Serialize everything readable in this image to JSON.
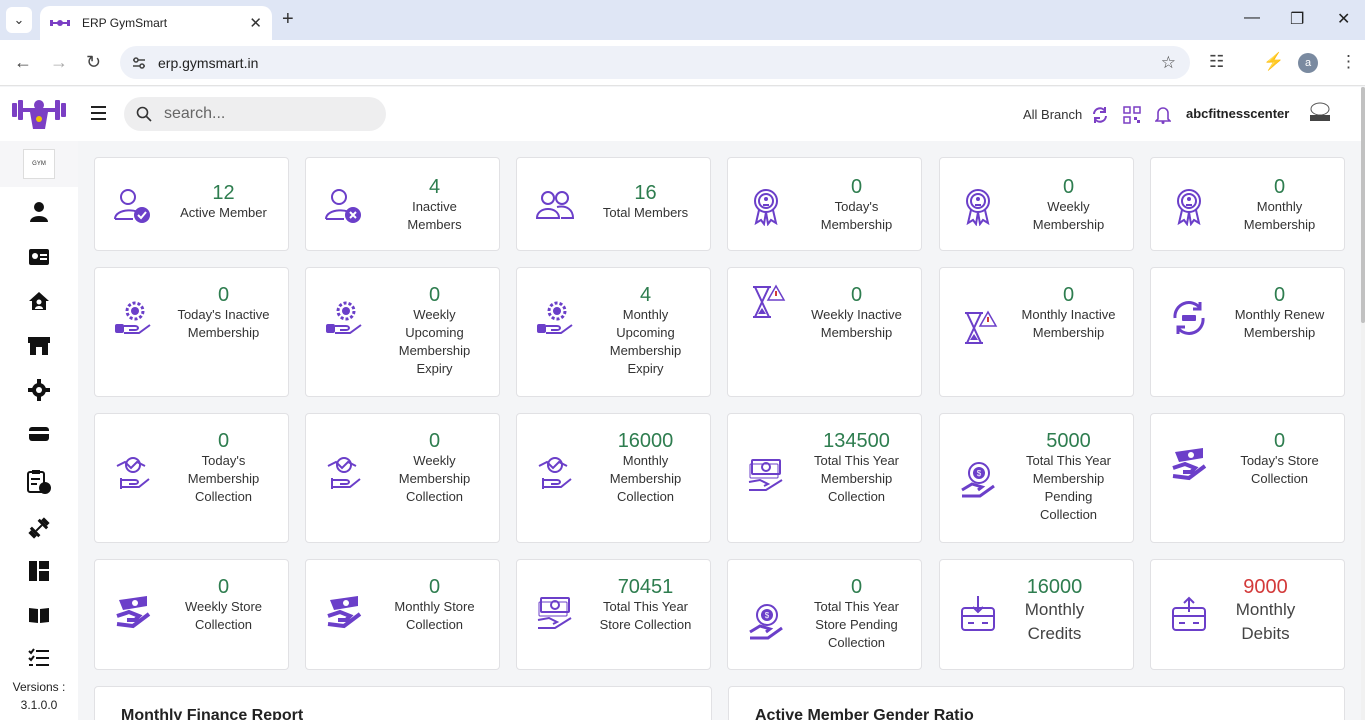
{
  "browser": {
    "tab_title": "ERP GymSmart",
    "url": "erp.gymsmart.in",
    "profile_initial": "a"
  },
  "sidebar": {
    "version": "Versions : 3.1.0.0",
    "items": [
      "user-icon",
      "id-card-icon",
      "house-user-icon",
      "store-icon",
      "settings-icon",
      "wallet-icon",
      "clipboard-clock-icon",
      "dumbbell-icon",
      "dashboard-icon",
      "book-icon",
      "task-list-icon"
    ]
  },
  "header": {
    "search_placeholder": "search...",
    "branch": "All Branch",
    "username": "abcfitnesscenter"
  },
  "colors": {
    "accent": "#6b3fc9",
    "value_green": "#2e7d4f",
    "value_red": "#d33a3a"
  },
  "cards": [
    {
      "value": "12",
      "label": "Active Member",
      "icon": "user-check-icon"
    },
    {
      "value": "4",
      "label": "Inactive Members",
      "icon": "user-x-icon"
    },
    {
      "value": "16",
      "label": "Total Members",
      "icon": "users-icon"
    },
    {
      "value": "0",
      "label": "Today's Membership",
      "icon": "award-ribbon-icon"
    },
    {
      "value": "0",
      "label": "Weekly Membership",
      "icon": "award-ribbon-icon"
    },
    {
      "value": "0",
      "label": "Monthly Membership",
      "icon": "award-ribbon-icon"
    },
    {
      "value": "0",
      "label": "Today's Inactive Membership",
      "icon": "hand-gear-icon"
    },
    {
      "value": "0",
      "label": "Weekly Upcoming Membership Expiry",
      "icon": "hand-gear-icon"
    },
    {
      "value": "4",
      "label": "Monthly Upcoming Membership Expiry",
      "icon": "hand-gear-icon"
    },
    {
      "value": "0",
      "label": "Weekly Inactive Membership",
      "icon": "hourglass-alert-icon"
    },
    {
      "value": "0",
      "label": "Monthly Inactive Membership",
      "icon": "hourglass-alert-icon"
    },
    {
      "value": "0",
      "label": "Monthly Renew Membership",
      "icon": "renew-icon"
    },
    {
      "value": "0",
      "label": "Today's Membership Collection",
      "icon": "handshake-icon"
    },
    {
      "value": "0",
      "label": "Weekly Membership Collection",
      "icon": "handshake-icon"
    },
    {
      "value": "16000",
      "label": "Monthly Membership Collection",
      "icon": "handshake-icon"
    },
    {
      "value": "134500",
      "label": "Total This Year Membership Collection",
      "icon": "cash-hand-icon"
    },
    {
      "value": "5000",
      "label": "Total This Year Membership Pending Collection",
      "icon": "coin-hand-icon"
    },
    {
      "value": "0",
      "label": "Today's Store Collection",
      "icon": "hand-money-icon"
    },
    {
      "value": "0",
      "label": "Weekly Store Collection",
      "icon": "hand-money-icon"
    },
    {
      "value": "0",
      "label": "Monthly Store Collection",
      "icon": "hand-money-icon"
    },
    {
      "value": "70451",
      "label": "Total This Year Store Collection",
      "icon": "cash-hand-icon"
    },
    {
      "value": "0",
      "label": "Total This Year Store Pending Collection",
      "icon": "coin-hand-icon"
    },
    {
      "value": "16000",
      "label": "Monthly Credits",
      "icon": "credit-box-icon"
    },
    {
      "value": "9000",
      "label": "Monthly Debits",
      "icon": "debit-box-icon"
    }
  ],
  "panels": {
    "finance_title": "Monthly Finance Report",
    "gender_title": "Active Member Gender Ratio"
  }
}
